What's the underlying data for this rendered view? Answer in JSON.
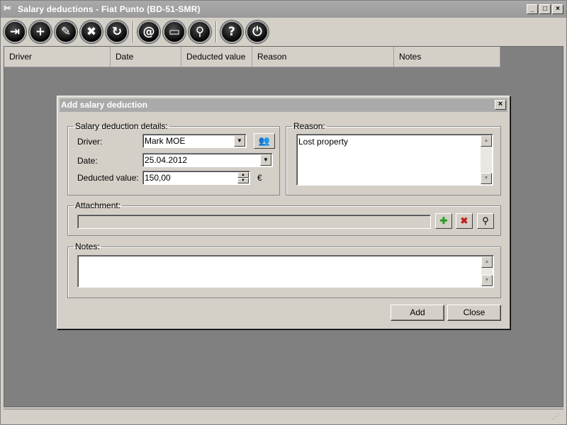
{
  "window": {
    "title": "Salary deductions - Fiat Punto (BD-51-SMR)",
    "icon": "scissors-icon",
    "controls": {
      "minimize": "_",
      "maximize": "□",
      "close": "×"
    }
  },
  "toolbar": {
    "buttons": [
      {
        "name": "exit",
        "icon": "exit-door-icon",
        "glyph": "⇥"
      },
      {
        "name": "add",
        "icon": "plus-icon",
        "glyph": "+"
      },
      {
        "name": "edit",
        "icon": "pencil-icon",
        "glyph": "✎"
      },
      {
        "name": "delete",
        "icon": "x-icon",
        "glyph": "✖"
      },
      {
        "name": "refresh",
        "icon": "refresh-icon",
        "glyph": "↻"
      },
      {
        "name": "email",
        "icon": "at-sign-icon",
        "glyph": "@"
      },
      {
        "name": "print",
        "icon": "printer-icon",
        "glyph": "▭"
      },
      {
        "name": "search",
        "icon": "magnifier-icon",
        "glyph": "⚲"
      },
      {
        "name": "help",
        "icon": "question-icon",
        "glyph": "?"
      },
      {
        "name": "power",
        "icon": "power-icon",
        "glyph": "⏻"
      }
    ]
  },
  "grid": {
    "columns": [
      "Driver",
      "Date",
      "Deducted value",
      "Reason",
      "Notes"
    ]
  },
  "dialog": {
    "title": "Add salary deduction",
    "close": "×",
    "details": {
      "legend": "Salary deduction details:",
      "driver_label": "Driver:",
      "driver_value": "Mark MOE",
      "date_label": "Date:",
      "date_value": "25.04.2012",
      "value_label": "Deducted value:",
      "value_value": "150,00",
      "currency": "€"
    },
    "reason": {
      "legend": "Reason:",
      "value": "Lost property"
    },
    "attachment": {
      "legend": "Attachment:",
      "value": ""
    },
    "notes": {
      "legend": "Notes:",
      "value": ""
    },
    "buttons": {
      "add": "Add",
      "close": "Close"
    }
  },
  "colors": {
    "titlebar": "#9e9e9e",
    "dialog_titlebar": "#aaaaaa",
    "grid_background": "#808080",
    "face": "#d4d0c8"
  }
}
